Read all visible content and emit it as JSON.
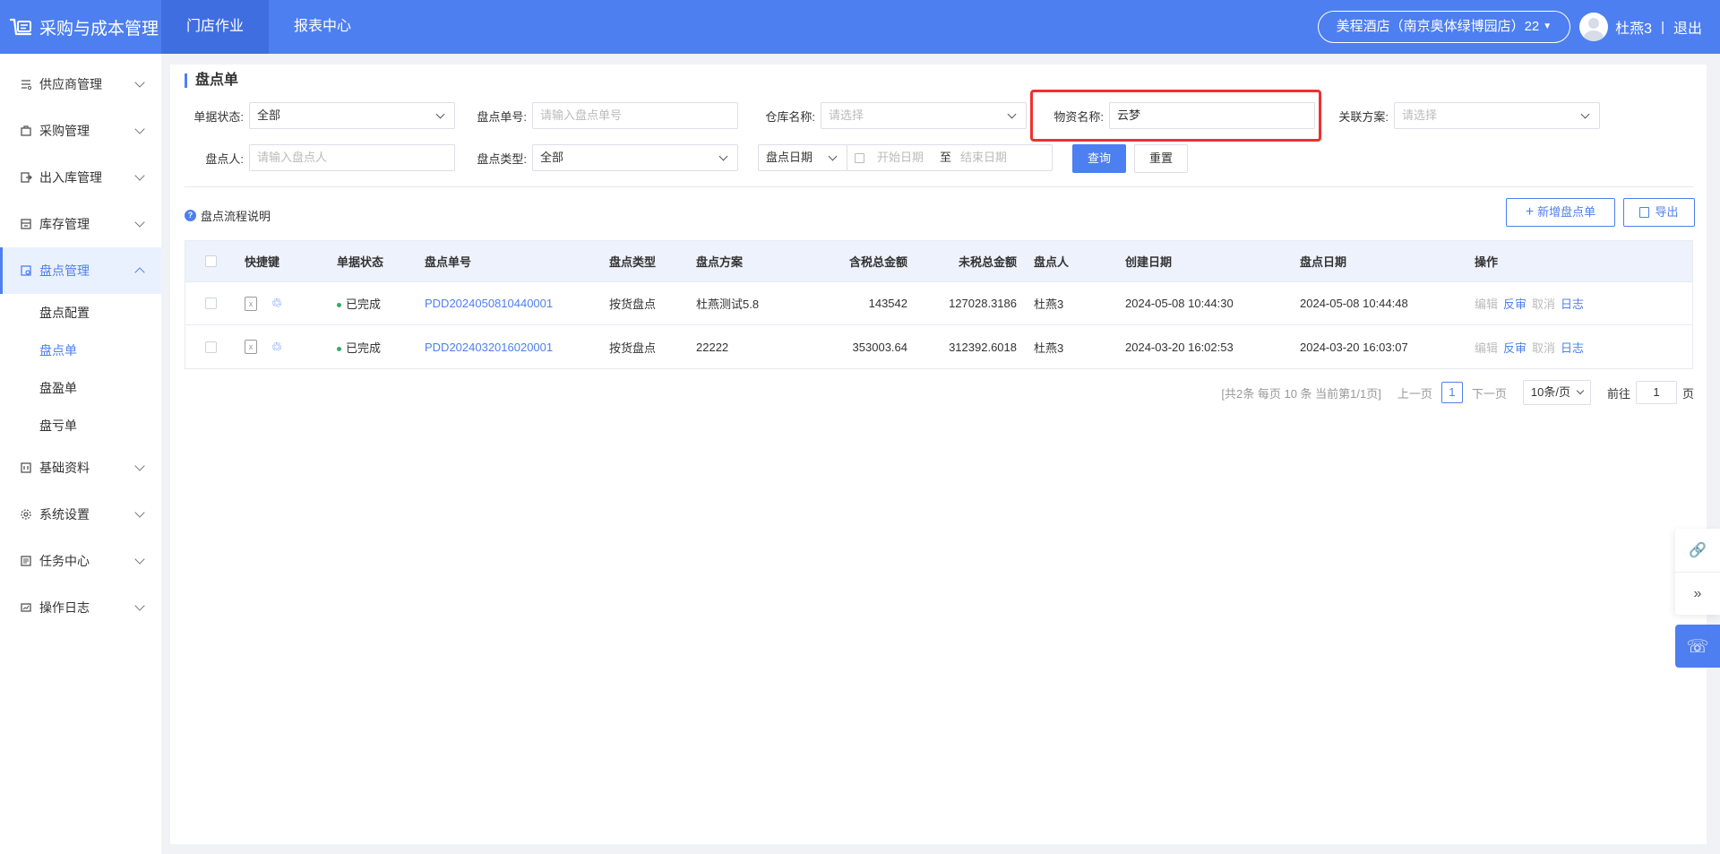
{
  "header": {
    "app_title": "采购与成本管理",
    "nav": [
      "门店作业",
      "报表中心"
    ],
    "store": "美程酒店（南京奥体绿博园店）22",
    "user": "杜燕3",
    "separator": "|",
    "logout": "退出"
  },
  "sidebar": {
    "items": [
      {
        "label": "供应商管理",
        "icon": "supplier-icon"
      },
      {
        "label": "采购管理",
        "icon": "purchase-icon"
      },
      {
        "label": "出入库管理",
        "icon": "warehouse-io-icon"
      },
      {
        "label": "库存管理",
        "icon": "inventory-icon"
      },
      {
        "label": "盘点管理",
        "icon": "stocktake-icon"
      },
      {
        "label": "基础资料",
        "icon": "base-data-icon"
      },
      {
        "label": "系统设置",
        "icon": "gear-icon"
      },
      {
        "label": "任务中心",
        "icon": "task-icon"
      },
      {
        "label": "操作日志",
        "icon": "log-icon"
      }
    ],
    "sub_items": [
      "盘点配置",
      "盘点单",
      "盘盈单",
      "盘亏单"
    ]
  },
  "page": {
    "title": "盘点单",
    "flow_help": "盘点流程说明"
  },
  "filters": {
    "status_label": "单据状态:",
    "status_value": "全部",
    "order_no_label": "盘点单号:",
    "order_no_placeholder": "请输入盘点单号",
    "warehouse_label": "仓库名称:",
    "warehouse_placeholder": "请选择",
    "material_label": "物资名称:",
    "material_value": "云梦",
    "plan_label": "关联方案:",
    "plan_placeholder": "请选择",
    "person_label": "盘点人:",
    "person_placeholder": "请输入盘点人",
    "type_label": "盘点类型:",
    "type_value": "全部",
    "date_type": "盘点日期",
    "start_date_placeholder": "开始日期",
    "date_to": "至",
    "end_date_placeholder": "结束日期",
    "query_btn": "查询",
    "reset_btn": "重置"
  },
  "actions": {
    "add": "新增盘点单",
    "export": "导出"
  },
  "table": {
    "columns": [
      "快捷键",
      "单据状态",
      "盘点单号",
      "盘点类型",
      "盘点方案",
      "含税总金额",
      "未税总金额",
      "盘点人",
      "创建日期",
      "盘点日期",
      "操作"
    ],
    "rows": [
      {
        "status": "已完成",
        "order_no": "PDD2024050810440001",
        "type": "按货盘点",
        "plan": "杜燕测试5.8",
        "tax_total": "143542",
        "notax_total": "127028.3186",
        "person": "杜燕3",
        "created": "2024-05-08 10:44:30",
        "stock_date": "2024-05-08 10:44:48"
      },
      {
        "status": "已完成",
        "order_no": "PDD2024032016020001",
        "type": "按货盘点",
        "plan": "22222",
        "tax_total": "353003.64",
        "notax_total": "312392.6018",
        "person": "杜燕3",
        "created": "2024-03-20 16:02:53",
        "stock_date": "2024-03-20 16:03:07"
      }
    ],
    "ops": {
      "edit": "编辑",
      "reverse": "反审",
      "cancel": "取消",
      "log": "日志"
    }
  },
  "pagination": {
    "summary": "[共2条 每页 10 条 当前第1/1页]",
    "prev": "上一页",
    "current": "1",
    "next": "下一页",
    "page_size": "10条/页",
    "goto_label": "前往",
    "goto_value": "1",
    "goto_suffix": "页"
  },
  "colors": {
    "primary": "#4e7ff0",
    "highlight": "#f03030",
    "success": "#2fae5f"
  }
}
